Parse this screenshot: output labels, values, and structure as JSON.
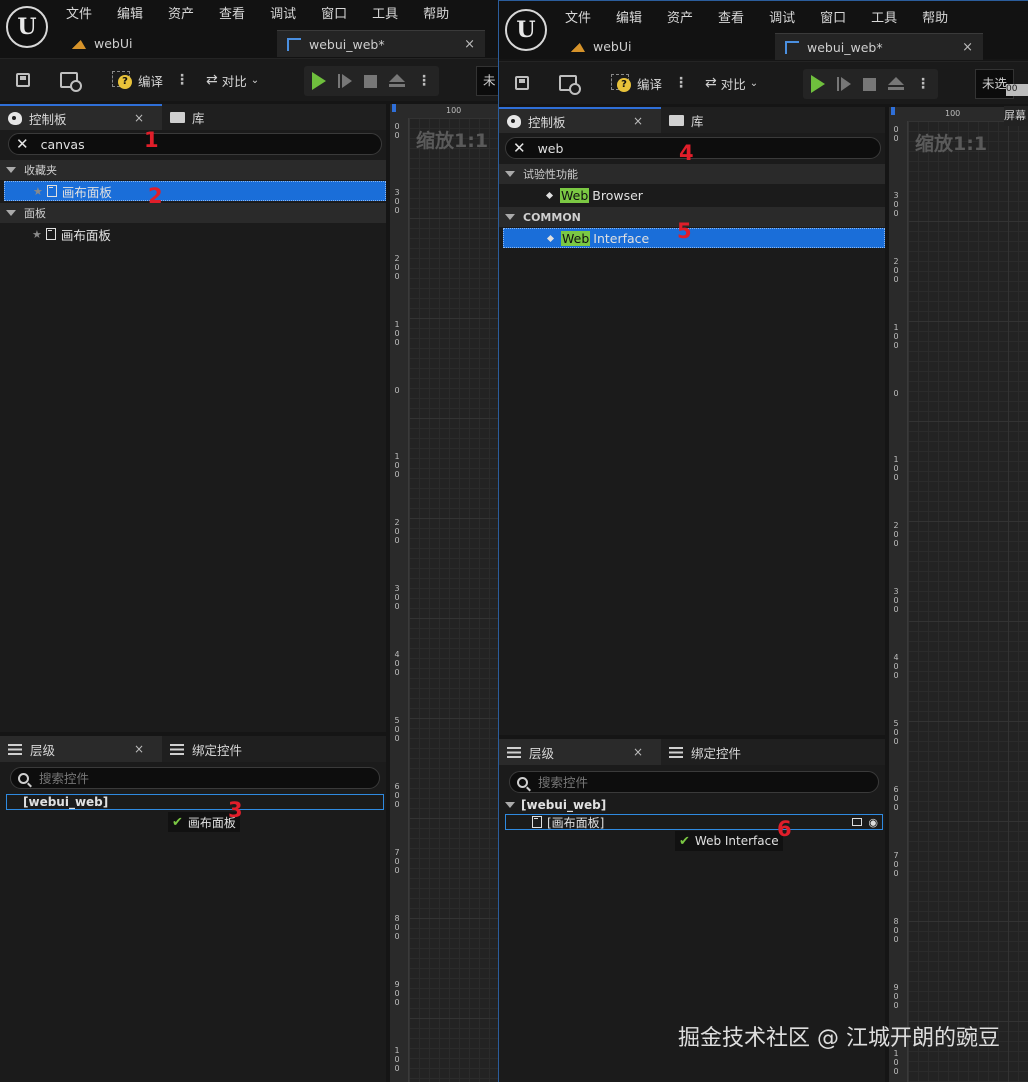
{
  "left": {
    "menu": [
      "文件",
      "编辑",
      "资产",
      "查看",
      "调试",
      "窗口",
      "工具",
      "帮助"
    ],
    "tabs": [
      {
        "label": "webUi"
      },
      {
        "label": "webui_web*"
      }
    ],
    "tab_close": "×",
    "toolbar": {
      "compile": "编译",
      "diff": "对比",
      "truncated": "未"
    },
    "palette": {
      "title": "控制板",
      "library": "库",
      "close": "×",
      "search_value": "canvas"
    },
    "categories": [
      {
        "label": "收藏夹",
        "item": "画布面板",
        "selected": true
      },
      {
        "label": "面板",
        "item": "画布面板",
        "selected": false
      }
    ],
    "hierarchy": {
      "title": "层级",
      "bind": "绑定控件",
      "close": "×",
      "search_placeholder": "搜索控件",
      "root": "[webui_web]",
      "drag_item": "画布面板"
    },
    "zoom": "缩放1:1",
    "ruler_top": "100",
    "annotations": [
      "1",
      "2",
      "3"
    ]
  },
  "right": {
    "menu": [
      "文件",
      "编辑",
      "资产",
      "查看",
      "调试",
      "窗口",
      "工具",
      "帮助"
    ],
    "tabs": [
      {
        "label": "webUi"
      },
      {
        "label": "webui_web*"
      }
    ],
    "tab_close": "×",
    "toolbar": {
      "compile": "编译",
      "diff": "对比",
      "truncated": "未选"
    },
    "palette": {
      "title": "控制板",
      "library": "库",
      "close": "×",
      "search_value": "web"
    },
    "categories": [
      {
        "label": "试验性功能",
        "item_hl": "Web",
        "item_rest": "Browser",
        "selected": false
      },
      {
        "label": "COMMON",
        "item_hl": "Web",
        "item_rest": "Interface",
        "selected": true
      }
    ],
    "hierarchy": {
      "title": "层级",
      "bind": "绑定控件",
      "close": "×",
      "search_placeholder": "搜索控件",
      "root": "[webui_web]",
      "child": "[画布面板]",
      "drag_item": "Web Interface"
    },
    "zoom": "缩放1:1",
    "ruler_top": "100",
    "corner_text": "屏幕",
    "corner_top": "00",
    "annotations": [
      "4",
      "5",
      "6"
    ]
  },
  "ruler_labels": [
    [
      "0",
      "0"
    ],
    [
      "3",
      "0",
      "0"
    ],
    [
      "2",
      "0",
      "0"
    ],
    [
      "1",
      "0",
      "0"
    ],
    [
      "0"
    ],
    [
      "1",
      "0",
      "0"
    ],
    [
      "2",
      "0",
      "0"
    ],
    [
      "3",
      "0",
      "0"
    ],
    [
      "4",
      "0",
      "0"
    ],
    [
      "5",
      "0",
      "0"
    ],
    [
      "6",
      "0",
      "0"
    ],
    [
      "7",
      "0",
      "0"
    ],
    [
      "8",
      "0",
      "0"
    ],
    [
      "9",
      "0",
      "0"
    ],
    [
      "1",
      "0",
      "0"
    ]
  ],
  "watermark": "掘金技术社区 @ 江城开朗的豌豆",
  "colors": {
    "accent": "#1a6ed9",
    "highlight": "#7bc843",
    "annotation": "#e01e2a",
    "play": "#6fbf3d"
  }
}
